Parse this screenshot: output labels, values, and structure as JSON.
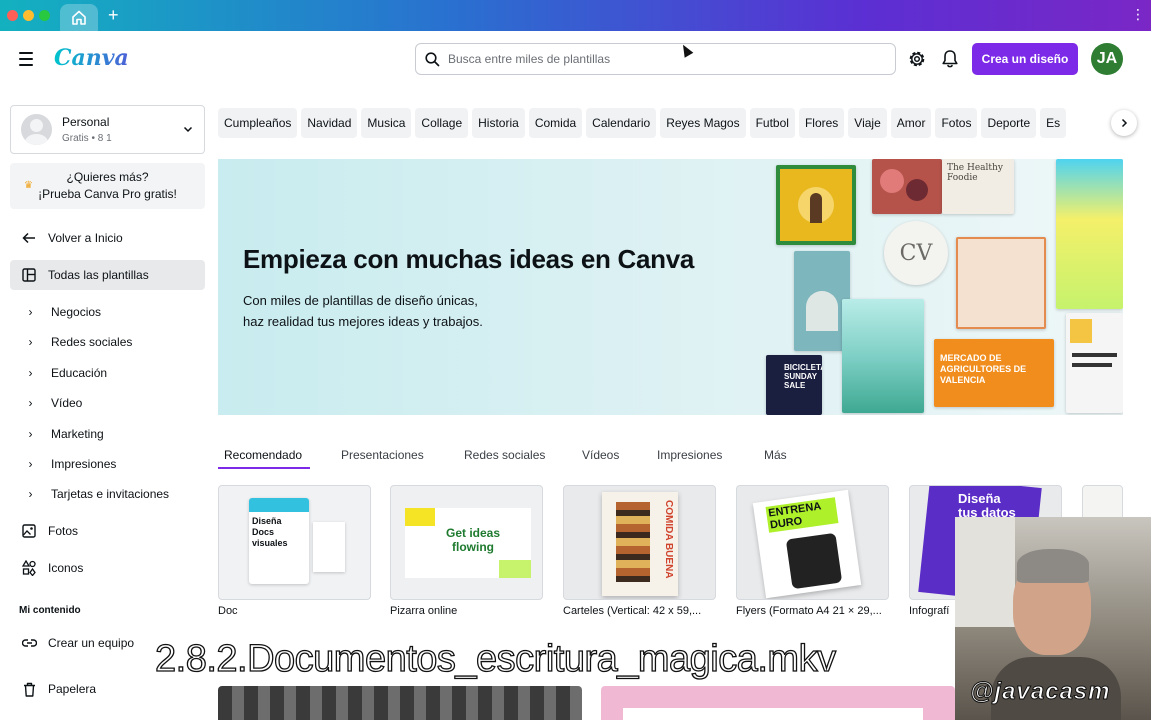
{
  "window": {
    "new_tab_symbol": "+",
    "menu_symbol": "⋮"
  },
  "header": {
    "logo": "Canva",
    "search_placeholder": "Busca entre miles de plantillas",
    "create_button": "Crea un diseño",
    "avatar_initials": "JA",
    "accent": "#7d2ae8"
  },
  "sidebar": {
    "account_name": "Personal",
    "account_sub": "Gratis • 8 1",
    "promo_line1": "¿Quieres más?",
    "promo_line2": "¡Prueba Canva Pro gratis!",
    "back": "Volver a Inicio",
    "all_templates": "Todas las plantillas",
    "categories": [
      "Negocios",
      "Redes sociales",
      "Educación",
      "Vídeo",
      "Marketing",
      "Impresiones",
      "Tarjetas e invitaciones"
    ],
    "photos": "Fotos",
    "icons": "Iconos",
    "my_content": "Mi contenido",
    "create_team": "Crear un equipo",
    "trash": "Papelera"
  },
  "chips": [
    "Cumpleaños",
    "Navidad",
    "Musica",
    "Collage",
    "Historia",
    "Comida",
    "Calendario",
    "Reyes Magos",
    "Futbol",
    "Flores",
    "Viaje",
    "Amor",
    "Fotos",
    "Deporte",
    "Es"
  ],
  "hero": {
    "title": "Empieza con muchas ideas en Canva",
    "line1": "Con miles de plantillas de diseño únicas,",
    "line2": "haz realidad tus mejores ideas y trabajos.",
    "card_foodie": "The Healthy Foodie",
    "card_cv": "CV",
    "card_mercado": "MERCADO DE AGRICULTORES DE VALENCIA",
    "card_bici": "BICICLETA SUNDAY SALE"
  },
  "tabs": [
    "Recomendado",
    "Presentaciones",
    "Redes sociales",
    "Vídeos",
    "Impresiones",
    "Más"
  ],
  "thumbs": [
    {
      "label": "Doc",
      "text": "Diseña Docs visuales"
    },
    {
      "label": "Pizarra online",
      "text": "Get ideas flowing"
    },
    {
      "label": "Carteles (Vertical: 42 x 59,...",
      "text": "COMIDA BUENA"
    },
    {
      "label": "Flyers (Formato A4 21 × 29,...",
      "text": "ENTRENA DURO"
    },
    {
      "label": "Infografí",
      "text": "Diseña tus datos"
    }
  ],
  "overlay": {
    "video_title": "2.8.2.Documentos_escritura_magica.mkv",
    "webcam_tag": "@javacasm"
  }
}
